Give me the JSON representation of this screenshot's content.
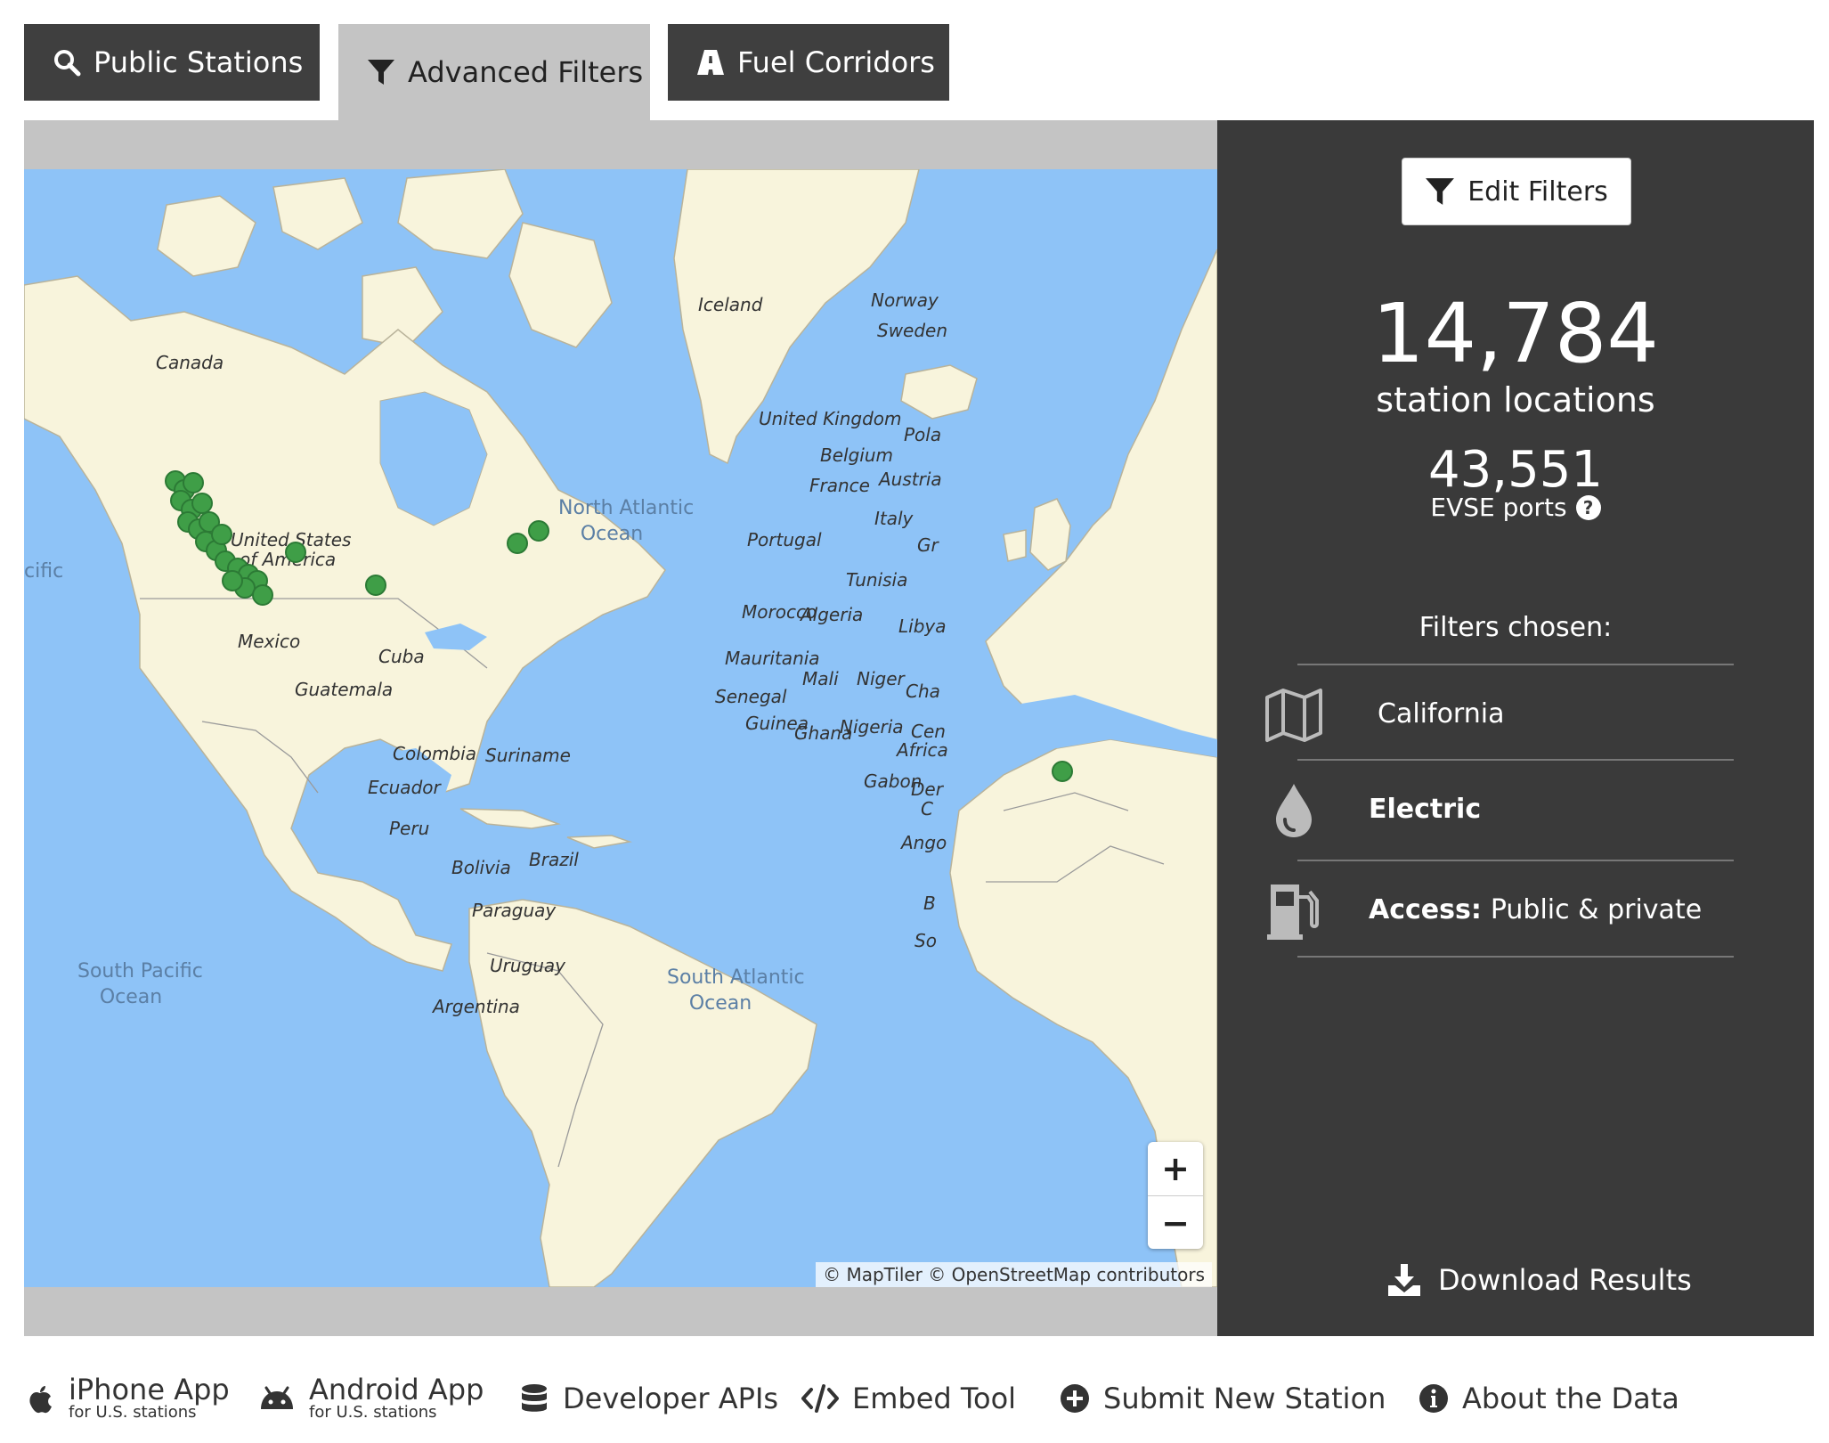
{
  "tabs": [
    {
      "label": "Public Stations",
      "icon": "search-icon",
      "active": false
    },
    {
      "label": "Advanced Filters",
      "icon": "filter-icon",
      "active": true
    },
    {
      "label": "Fuel Corridors",
      "icon": "road-icon",
      "active": false
    }
  ],
  "map": {
    "labels": {
      "canada": "Canada",
      "usa_line1": "United States",
      "usa_line2": "of America",
      "mexico": "Mexico",
      "cuba": "Cuba",
      "guatemala": "Guatemala",
      "colombia": "Colombia",
      "suriname": "Suriname",
      "ecuador": "Ecuador",
      "peru": "Peru",
      "brazil": "Brazil",
      "bolivia": "Bolivia",
      "paraguay": "Paraguay",
      "uruguay": "Uruguay",
      "argentina": "Argentina",
      "iceland": "Iceland",
      "norway": "Norway",
      "sweden": "Sweden",
      "united_kingdom": "United Kingdom",
      "poland": "Pola",
      "belgium": "Belgium",
      "france": "France",
      "austria": "Austria",
      "italy": "Italy",
      "greece": "Gr",
      "portugal": "Portugal",
      "tunisia": "Tunisia",
      "morocco": "Morocco",
      "algeria": "Algeria",
      "libya": "Libya",
      "mauritania": "Mauritania",
      "mali": "Mali",
      "niger": "Niger",
      "chad": "Cha",
      "senegal": "Senegal",
      "guinea": "Guinea",
      "ghana": "Ghana",
      "nigeria": "Nigeria",
      "car_line1": "Cen",
      "car_line2": "Africa",
      "gabon": "Gabon",
      "drc_line1": "Der",
      "drc_line2": "C",
      "angola": "Ango",
      "botswana": "B",
      "south_africa": "So",
      "pacific": "cific"
    },
    "oceans": {
      "north_atlantic_line1": "North Atlantic",
      "north_atlantic_line2": "Ocean",
      "south_pacific_line1": "South Pacific",
      "south_pacific_line2": "Ocean",
      "south_atlantic_line1": "South Atlantic",
      "south_atlantic_line2": "Ocean"
    },
    "zoom_in": "+",
    "zoom_out": "−",
    "attribution": "© MapTiler © OpenStreetMap contributors",
    "marker_color": "#3f9e47"
  },
  "sidebar": {
    "edit_filters": "Edit Filters",
    "station_count": "14,784",
    "station_label": "station locations",
    "port_count": "43,551",
    "port_label": "EVSE ports",
    "help": "?",
    "filters_title": "Filters chosen:",
    "filters": [
      {
        "icon": "map-icon",
        "label": "",
        "value": "California"
      },
      {
        "icon": "drop-icon",
        "label": "Electric",
        "value": ""
      },
      {
        "icon": "fuel-pump-icon",
        "label": "Access:",
        "value": "Public & private"
      }
    ],
    "download": "Download Results"
  },
  "footer": [
    {
      "icon": "apple-icon",
      "title": "iPhone App",
      "sub": "for U.S. stations"
    },
    {
      "icon": "android-icon",
      "title": "Android App",
      "sub": "for U.S. stations"
    },
    {
      "icon": "database-icon",
      "title": "Developer APIs",
      "sub": ""
    },
    {
      "icon": "code-icon",
      "title": "Embed Tool",
      "sub": ""
    },
    {
      "icon": "plus-circle-icon",
      "title": "Submit New Station",
      "sub": ""
    },
    {
      "icon": "info-icon",
      "title": "About the Data",
      "sub": ""
    }
  ],
  "colors": {
    "water": "#8ec3f7",
    "land": "#f8f4dc",
    "sidebar": "#3a3a3a",
    "tab_dark": "#3f3f3f",
    "tab_active": "#c4c4c4"
  }
}
